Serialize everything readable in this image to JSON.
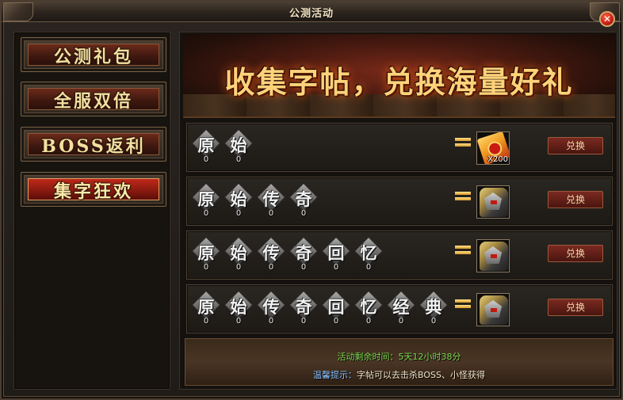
{
  "window": {
    "title": "公测活动"
  },
  "sidebar": {
    "items": [
      {
        "label": "公测礼包",
        "active": false
      },
      {
        "label": "全服双倍",
        "active": false
      },
      {
        "label": "BOSS返利",
        "active": false
      },
      {
        "label": "集字狂欢",
        "active": true
      }
    ]
  },
  "banner": {
    "title": "收集字帖，兑换海量好礼"
  },
  "rows": [
    {
      "chars": [
        {
          "glyph": "原",
          "count": "0"
        },
        {
          "glyph": "始",
          "count": "0"
        }
      ],
      "reward": {
        "icon": "scroll-icon",
        "qty": "X200"
      },
      "button": "兑换"
    },
    {
      "chars": [
        {
          "glyph": "原",
          "count": "0"
        },
        {
          "glyph": "始",
          "count": "0"
        },
        {
          "glyph": "传",
          "count": "0"
        },
        {
          "glyph": "奇",
          "count": "0"
        }
      ],
      "reward": {
        "icon": "armor-icon",
        "qty": ""
      },
      "button": "兑换"
    },
    {
      "chars": [
        {
          "glyph": "原",
          "count": "0"
        },
        {
          "glyph": "始",
          "count": "0"
        },
        {
          "glyph": "传",
          "count": "0"
        },
        {
          "glyph": "奇",
          "count": "0"
        },
        {
          "glyph": "回",
          "count": "0"
        },
        {
          "glyph": "忆",
          "count": "0"
        }
      ],
      "reward": {
        "icon": "armor-icon",
        "qty": ""
      },
      "button": "兑换"
    },
    {
      "chars": [
        {
          "glyph": "原",
          "count": "0"
        },
        {
          "glyph": "始",
          "count": "0"
        },
        {
          "glyph": "传",
          "count": "0"
        },
        {
          "glyph": "奇",
          "count": "0"
        },
        {
          "glyph": "回",
          "count": "0"
        },
        {
          "glyph": "忆",
          "count": "0"
        },
        {
          "glyph": "经",
          "count": "0"
        },
        {
          "glyph": "典",
          "count": "0"
        }
      ],
      "reward": {
        "icon": "armor-icon",
        "qty": ""
      },
      "button": "兑换"
    }
  ],
  "footer": {
    "remaining": "活动剩余时间：5天12小时38分",
    "tip_label": "温馨提示：",
    "tip_text": "字帖可以去击杀BOSS、小怪获得"
  },
  "colors": {
    "accent_gold": "#ffd27a",
    "active_red": "#c0281a",
    "timer_green": "#7ad850",
    "tip_blue": "#8ac0ff"
  }
}
